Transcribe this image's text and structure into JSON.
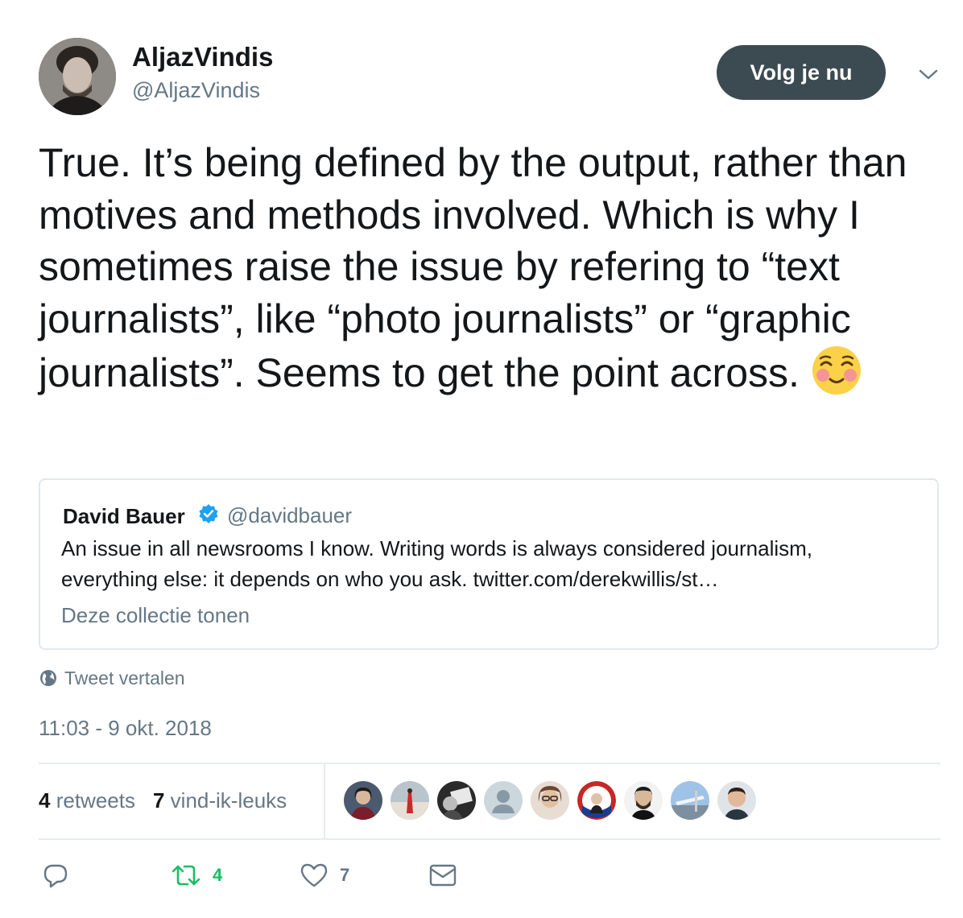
{
  "author": {
    "name": "AljazVindis",
    "handle": "@AljazVindis"
  },
  "follow_button_label": "Volg je nu",
  "tweet": {
    "text": "True. It’s being defined by the output, rather than motives and methods involved. Which is why I sometimes raise the issue by refering to “text journalists”, like “photo journalists” or “graphic journalists”. Seems to get the point across.",
    "emoji_icon": "smiling-face-with-blush-icon"
  },
  "quoted_tweet": {
    "name": "David Bauer",
    "handle": "@davidbauer",
    "text": "An issue in all newsrooms I know. Writing words is always considered journalism, everything else: it depends on who you ask. twitter.com/derekwillis/st…",
    "show_collection_label": "Deze collectie tonen"
  },
  "translate_label": "Tweet vertalen",
  "timestamp": "11:03 - 9 okt. 2018",
  "stats": {
    "retweets_count": "4",
    "retweets_label": "retweets",
    "likes_count": "7",
    "likes_label": "vind-ik-leuks"
  },
  "actions": {
    "retweet_count": "4",
    "like_count": "7"
  },
  "colors": {
    "follow_button_bg": "#3c4a52",
    "secondary_text": "#657786",
    "retweet_green": "#17bf63",
    "verified_blue": "#1da1f2"
  }
}
